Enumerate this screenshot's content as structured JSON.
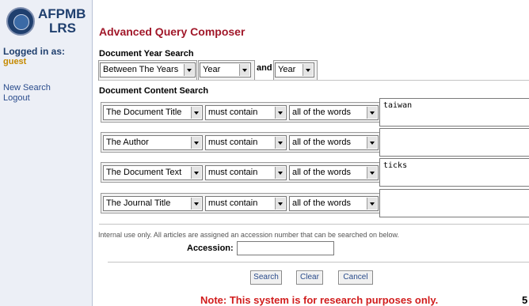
{
  "sidebar": {
    "logo_line1": "AFPMB",
    "logo_line2": "LRS",
    "logged_in_label": "Logged in as:",
    "username": "guest",
    "nav": [
      "New Search",
      "Logout"
    ]
  },
  "main": {
    "title": "Advanced Query Composer",
    "year_search": {
      "label": "Document Year Search",
      "range_type": "Between The Years",
      "from_year": "Year",
      "and_label": "and",
      "to_year": "Year"
    },
    "content_search": {
      "label": "Document Content Search",
      "rows": [
        {
          "field": "The Document Title",
          "operator": "must contain",
          "mode": "all of the words",
          "terms": "taiwan"
        },
        {
          "field": "The Author",
          "operator": "must contain",
          "mode": "all of the words",
          "terms": ""
        },
        {
          "field": "The Document Text",
          "operator": "must contain",
          "mode": "all of the words",
          "terms": "ticks"
        },
        {
          "field": "The Journal Title",
          "operator": "must contain",
          "mode": "all of the words",
          "terms": ""
        }
      ]
    },
    "internal_note": "Internal use only. All articles are assigned an accession number that can be searched on below.",
    "accession_label": "Accession:",
    "accession_value": "",
    "buttons": {
      "search": "Search",
      "clear": "Clear",
      "cancel": "Cancel"
    },
    "disclaimer": "Note: This system is for research purposes only.",
    "page_number": "5"
  }
}
